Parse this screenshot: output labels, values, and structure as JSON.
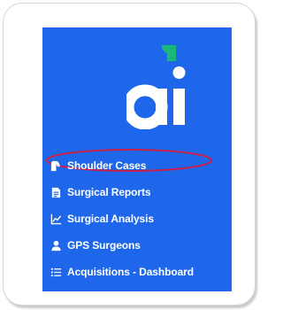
{
  "brand": {
    "logo_text": "ai",
    "sidebar_color": "#1f67ea",
    "accent_color": "#19b77a",
    "annotation_color": "#c8204a"
  },
  "nav": {
    "items": [
      {
        "label": "Shoulder Cases",
        "icon": "shoulder-icon",
        "highlighted": true
      },
      {
        "label": "Surgical Reports",
        "icon": "document-icon",
        "highlighted": false
      },
      {
        "label": "Surgical Analysis",
        "icon": "line-chart-icon",
        "highlighted": false
      },
      {
        "label": "GPS Surgeons",
        "icon": "user-icon",
        "highlighted": false
      },
      {
        "label": "Acquisitions - Dashboard",
        "icon": "list-icon",
        "highlighted": false
      }
    ]
  }
}
